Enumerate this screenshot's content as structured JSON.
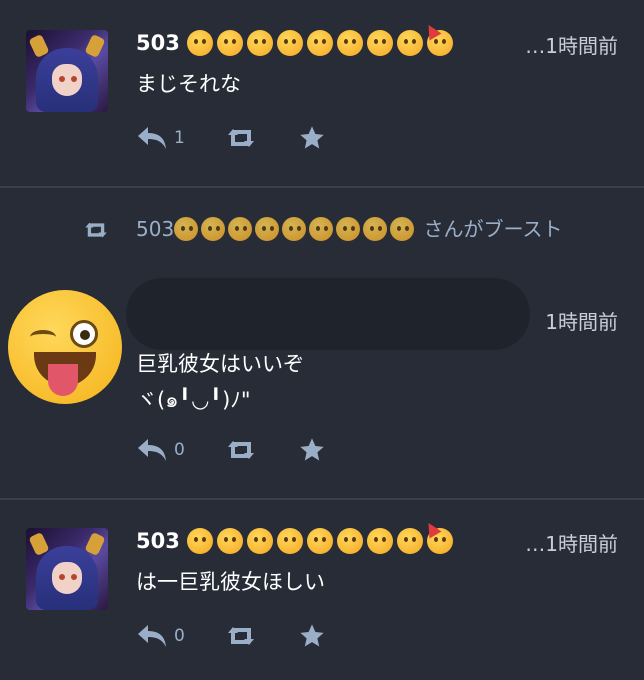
{
  "statuses": [
    {
      "author": "503",
      "time": "…1時間前",
      "content": "まじそれな",
      "reply_count": "1"
    },
    {
      "boost_suffix": " さんがブースト",
      "author": "503",
      "time": "1時間前",
      "content_lines": [
        "巨乳彼女はいいぞ",
        "ヾ(๑╹◡╹)ﾉ\""
      ],
      "reply_count": "0"
    },
    {
      "author": "503",
      "time": "…1時間前",
      "content": "は一巨乳彼女ほしい",
      "reply_count": "0"
    }
  ],
  "name_emojis": [
    "kissing-face",
    "woozy-face",
    "eye-roll-face",
    "worried-face",
    "thinking-face",
    "grinning-face",
    "hugging-face",
    "zany-face",
    "partying-face"
  ],
  "colors": {
    "background": "#282c37",
    "action": "#9baec8",
    "divider": "#393f4f"
  }
}
